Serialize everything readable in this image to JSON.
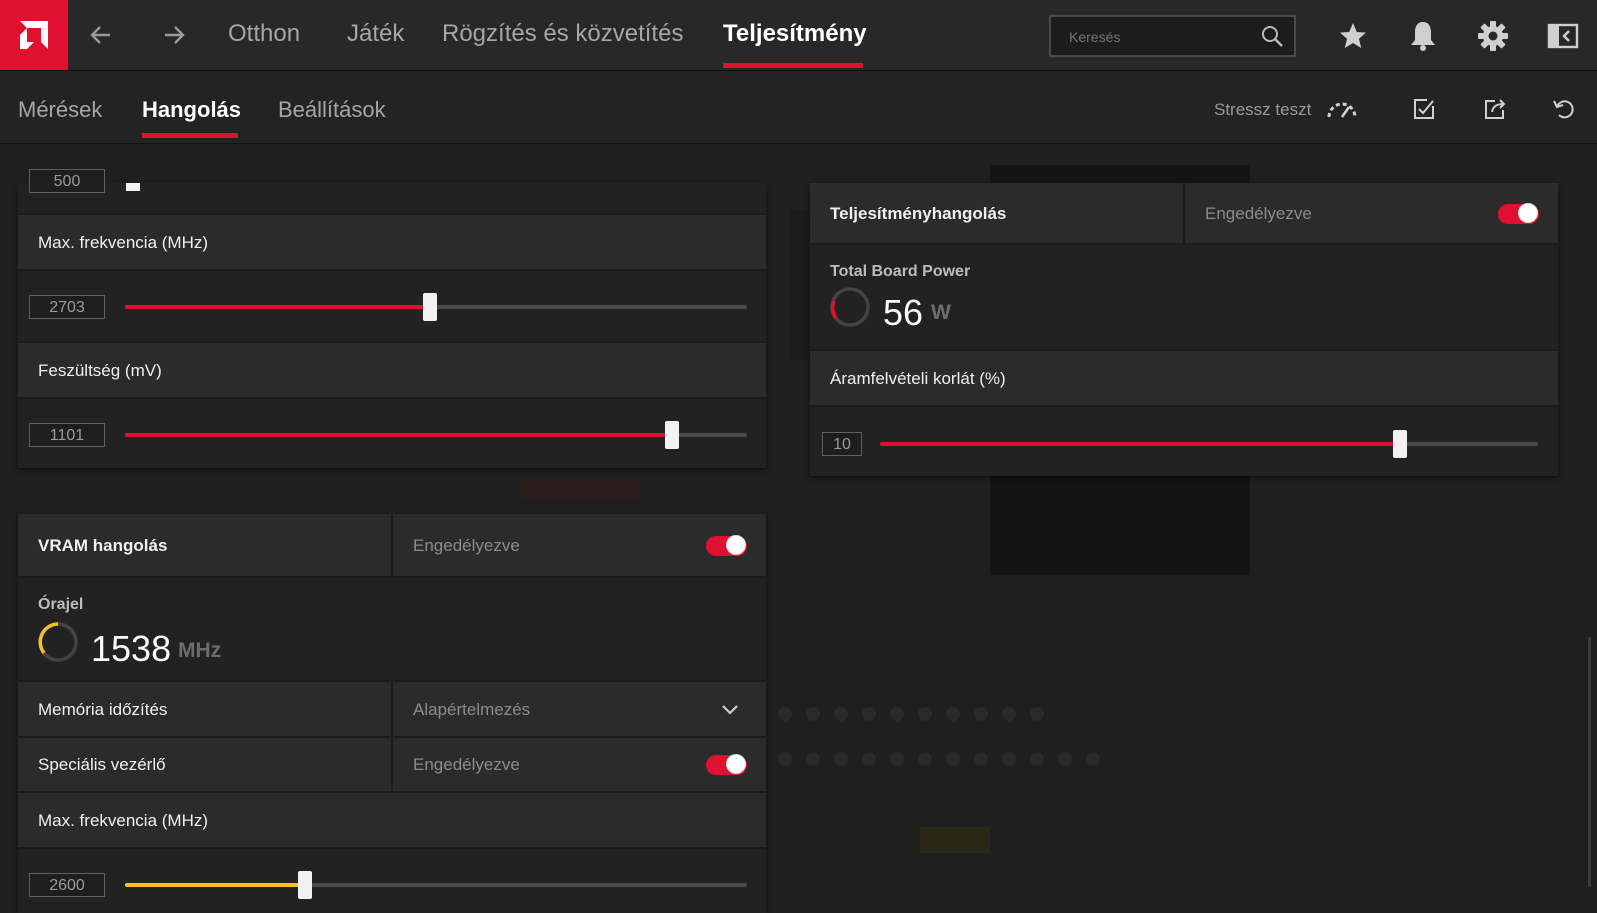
{
  "topnav": {
    "tabs": [
      "Otthon",
      "Játék",
      "Rögzítés és közvetítés",
      "Teljesítmény"
    ],
    "search_placeholder": "Keresés"
  },
  "subnav": {
    "tabs": [
      "Mérések",
      "Hangolás",
      "Beállítások"
    ],
    "stress_label": "Stressz teszt"
  },
  "gpu_panel": {
    "top_partial_value": "500",
    "max_freq": {
      "label": "Max. frekvencia (MHz)",
      "value": "2703",
      "fraction": 0.49
    },
    "voltage": {
      "label": "Feszültség (mV)",
      "value": "1101",
      "fraction": 0.88
    }
  },
  "vram_panel": {
    "title": "VRAM hangolás",
    "state": "Engedélyezve",
    "clock": {
      "label": "Órajel",
      "value": "1538",
      "unit": "MHz"
    },
    "mem_timing": {
      "label": "Memória időzítés",
      "value": "Alapértelmezés"
    },
    "special": {
      "label": "Speciális vezérlő",
      "state": "Engedélyezve"
    },
    "max_freq": {
      "label": "Max. frekvencia (MHz)",
      "value": "2600",
      "fraction": 0.29
    }
  },
  "power_panel": {
    "title": "Teljesítményhangolás",
    "state": "Engedélyezve",
    "tbp": {
      "label": "Total Board Power",
      "value": "56",
      "unit": "W"
    },
    "limit": {
      "label": "Áramfelvételi korlát (%)",
      "value": "10",
      "fraction": 0.79
    }
  },
  "colors": {
    "accent": "#e0102f",
    "vram": "#f5c02a"
  }
}
